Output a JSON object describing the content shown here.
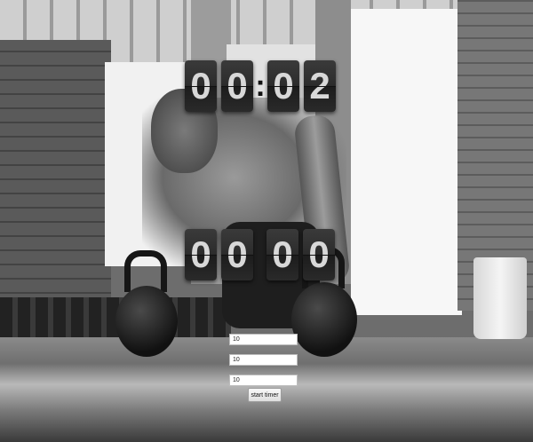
{
  "timer_display": {
    "minutes": [
      "0",
      "0"
    ],
    "seconds": [
      "0",
      "2"
    ],
    "separator": ":"
  },
  "round_display": {
    "left": [
      "0",
      "0"
    ],
    "right": [
      "0",
      "0"
    ]
  },
  "inputs": {
    "field_1_value": "10",
    "field_2_value": "10",
    "field_3_value": "10"
  },
  "start_button_label": "start timer"
}
